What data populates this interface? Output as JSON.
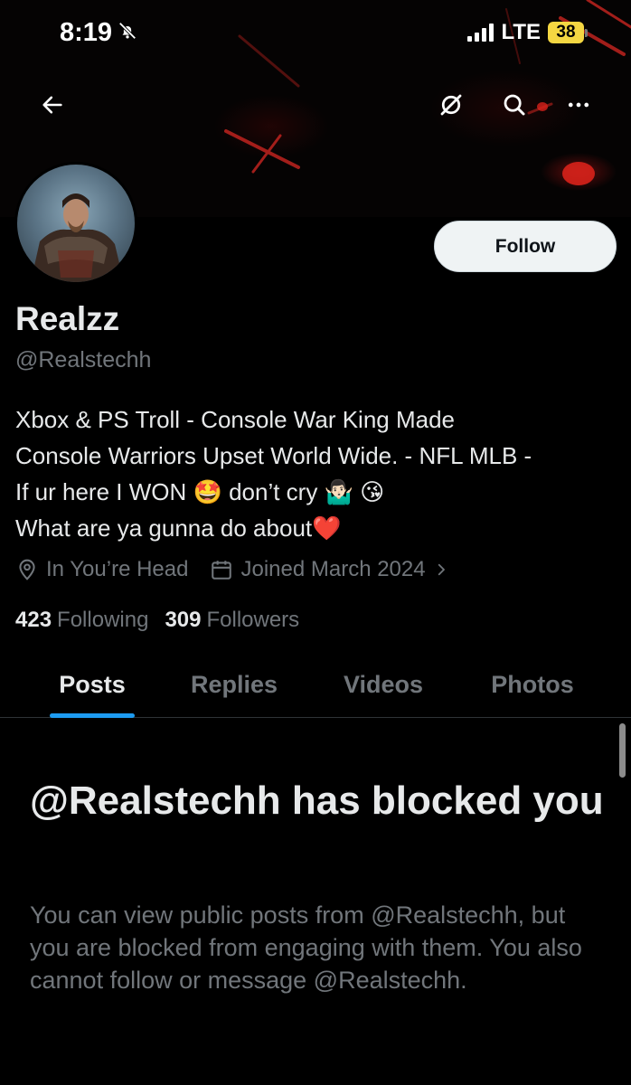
{
  "status_bar": {
    "time": "8:19",
    "network": "LTE",
    "battery": "38"
  },
  "nav": {
    "back_icon": "arrow-left-icon",
    "icons": [
      "eye-slash-icon",
      "search-icon",
      "more-icon"
    ]
  },
  "profile": {
    "follow_label": "Follow",
    "display_name": "Realzz",
    "handle": "@Realstechh",
    "bio": [
      "Xbox & PS Troll - Console War King Made",
      "Console Warriors Upset World Wide. - NFL MLB -",
      "If ur here I WON 🤩 don’t cry 🤷🏻‍♂️ 😘",
      "What are ya gunna do about❤️"
    ],
    "location": "In You’re Head",
    "joined": "Joined March 2024",
    "following_count": "423",
    "following_label": "Following",
    "followers_count": "309",
    "followers_label": "Followers"
  },
  "tabs": [
    {
      "label": "Posts",
      "active": true
    },
    {
      "label": "Replies",
      "active": false
    },
    {
      "label": "Videos",
      "active": false
    },
    {
      "label": "Photos",
      "active": false
    }
  ],
  "blocked": {
    "title": "@Realstechh has blocked you",
    "body": "You can view public posts from @Realstechh, but you are blocked from engaging with them. You also cannot follow or message @Realstechh."
  },
  "colors": {
    "accent": "#1d9bf0",
    "background": "#000000",
    "text_primary": "#e7e9ea",
    "text_secondary": "#71767b",
    "battery": "#f5d742"
  }
}
